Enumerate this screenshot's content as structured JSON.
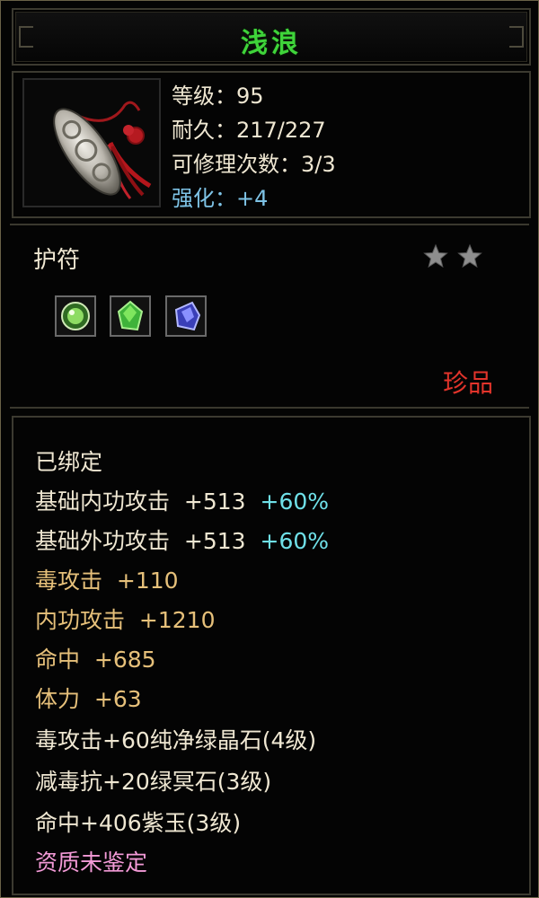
{
  "item": {
    "name": "浅浪",
    "level_text": "等级：95",
    "durability_text": "耐久：217/227",
    "repair_text": "可修理次数：3/3",
    "enhance_label": "强化：",
    "enhance_value": "+4",
    "category": "护符",
    "stars": 2,
    "rarity": "珍品",
    "gems": [
      {
        "icon": "green-round-gem-icon"
      },
      {
        "icon": "green-crystal-icon"
      },
      {
        "icon": "purple-crystal-icon"
      }
    ]
  },
  "attributes": {
    "bound": "已绑定",
    "base_inner": {
      "label": "基础内功攻击",
      "value": "+513",
      "bonus": "+60%"
    },
    "base_outer": {
      "label": "基础外功攻击",
      "value": "+513",
      "bonus": "+60%"
    },
    "poison_attack": {
      "label": "毒攻击",
      "value": "+110"
    },
    "inner_attack": {
      "label": "内功攻击",
      "value": "+1210"
    },
    "hit": {
      "label": "命中",
      "value": "+685"
    },
    "stamina": {
      "label": "体力",
      "value": "+63"
    },
    "socket_1": "毒攻击+60纯净绿晶石(4级)",
    "socket_2": "减毒抗+20绿冥石(3级)",
    "socket_3": "命中+406紫玉(3级)",
    "aptitude": "资质未鉴定"
  },
  "colors": {
    "title": "#3fd43a",
    "enhance": "#7ec3e6",
    "rarity": "#e2342b",
    "percent_bonus": "#6fe0e8",
    "stat_gold": "#e6c07a",
    "aptitude": "#f39ad7"
  }
}
